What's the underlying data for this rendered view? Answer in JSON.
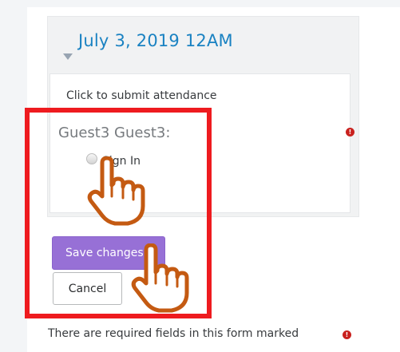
{
  "session": {
    "title": "July 3, 2019 12AM",
    "prompt": "Click to submit attendance"
  },
  "attendance": {
    "guest_label": "Guest3 Guest3:",
    "status_option": "Sign In",
    "required_icon": "exclamation-circle-icon"
  },
  "form": {
    "save_label": "Save changes",
    "cancel_label": "Cancel",
    "required_note": "There are required fields in this form marked"
  },
  "colors": {
    "title": "#1a82c2",
    "primary_button": "#9770d6",
    "highlight": "#ee1b1f",
    "required": "#c9211e",
    "pointer": "#c45a12"
  },
  "annotations": {
    "pointer_icon": "pointing-hand-icon"
  }
}
